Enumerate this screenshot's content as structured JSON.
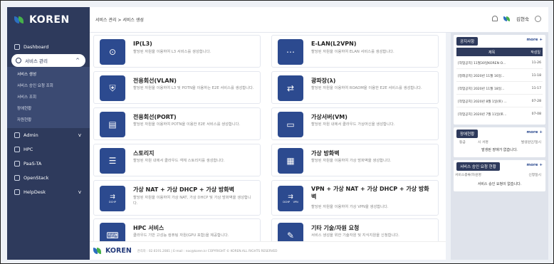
{
  "brand": {
    "name": "KOREN",
    "colors": {
      "navy": "#2e3a5c",
      "blue": "#2c4a8f",
      "green": "#46b04a"
    }
  },
  "sidebar": {
    "items": [
      {
        "label": "Dashboard",
        "icon": "home-icon"
      },
      {
        "label": "서비스 관리",
        "icon": "gear-icon",
        "active": true,
        "chevron": "^"
      },
      {
        "label": "Admin",
        "icon": "cloud-icon",
        "chevron": "v"
      },
      {
        "label": "HPC",
        "icon": "grid-icon"
      },
      {
        "label": "PaaS-TA",
        "icon": "cloud-icon"
      },
      {
        "label": "OpenStack",
        "icon": "window-icon"
      },
      {
        "label": "HelpDesk",
        "icon": "document-icon",
        "chevron": "v"
      }
    ],
    "sub_items": [
      "서비스 생성",
      "서비스 승인 요청 조회",
      "서비스 조회",
      "장애현황",
      "자원현황"
    ]
  },
  "topbar": {
    "breadcrumb": "서비스 관리 > 서비스 생성",
    "user": "김현숙"
  },
  "cards": [
    {
      "title": "IP(L3)",
      "desc": "할당된 자원을 이용하여 L3 서비스를 생성합니다.",
      "icon": "location-icon"
    },
    {
      "title": "E-LAN(L2VPN)",
      "desc": "할당된 자원을 이용하여 ELAN 서비스를 생성합니다.",
      "icon": "network-icon"
    },
    {
      "title": "전용회선(VLAN)",
      "desc": "할당된 자원을 이용하여 L3 및 POTN을 이용하는 E2E 서비스를 생성합니다.",
      "icon": "shield-icon"
    },
    {
      "title": "광파장(λ)",
      "desc": "할당된 자원을 이용하여 ROADM을 이용한 E2E 서비스를 생성합니다.",
      "icon": "transport-icon"
    },
    {
      "title": "전용회선(PORT)",
      "desc": "할당된 자원을 이용하여 POTN을 이용한 E2E 서비스를 생성합니다.",
      "icon": "port-icon"
    },
    {
      "title": "가상서버(VM)",
      "desc": "할당된 자원 내에서 클라우드 가상머신을 생성합니다.",
      "icon": "server-icon"
    },
    {
      "title": "스토리지",
      "desc": "할당된 자원 내에서 클라우드 객체 스토리지를 생성합니다.",
      "icon": "storage-icon"
    },
    {
      "title": "가상 방화벽",
      "desc": "할당된 자원을 이용하여 가상 방화벽을 생성합니다.",
      "icon": "firewall-icon"
    },
    {
      "title": "가상 NAT + 가상 DHCP + 가상 방화벽",
      "desc": "할당된 자원을 이용하여 가상 NAT, 가상 DHCP 및 가상 방화벽을 생성합니다.",
      "icon": "dhcp-icon",
      "sub": "DCHP"
    },
    {
      "title": "VPN + 가상 NAT + 가상 DHCP + 가상 방화벽",
      "desc": "할당된 자원을 이용하여 가상 VPN을 생성합니다.",
      "icon": "vpn-icon",
      "sub": "DCHP    VPN"
    },
    {
      "title": "HPC 서비스",
      "desc": "클라우드 기반 고성능 컴퓨팅 자원(GPU 포함)을 제공합니다.",
      "icon": "hpc-icon"
    },
    {
      "title": "기타 기술/자원 요청",
      "desc": "서비스 생성을 위한 기술자원 및 지식지원을 신청합니다.",
      "icon": "request-icon"
    }
  ],
  "footer": {
    "logo": "KOREN",
    "info": "관리자 : 02.6191.2081 | E-mail : noc@koren.kr     COPYRIGHT © KOREN.ALL RIGHTS RESERVED"
  },
  "right": {
    "notice": {
      "title": "공지사항",
      "more": "more +",
      "col_title": "제목",
      "col_date": "작성일",
      "rows": [
        {
          "title": "[작업공지] 11월30일KOREN O...",
          "date": "11-26"
        },
        {
          "title": "[정래공지] 2020년 11월 16일...",
          "date": "11-18"
        },
        {
          "title": "[작업공지] 2020년 11월 18일...",
          "date": "11-17"
        },
        {
          "title": "[작업공지] 2020년 8월 1일(토) ...",
          "date": "07-28"
        },
        {
          "title": "[작업공지] 2020년 7월 11일(토...",
          "date": "07-08"
        }
      ]
    },
    "incident": {
      "title": "장애현황",
      "more": "more +",
      "cols": [
        "등급",
        "시 서명",
        "발생원인/일시"
      ],
      "empty": "발생된 장애가 없습니다."
    },
    "approval": {
      "title": "서비스 승인 요청 현황",
      "more": "more +",
      "cols": [
        "서비스종류/자원명",
        "신청일시"
      ],
      "empty": "서비스 승인 요청이 없습니다."
    }
  }
}
